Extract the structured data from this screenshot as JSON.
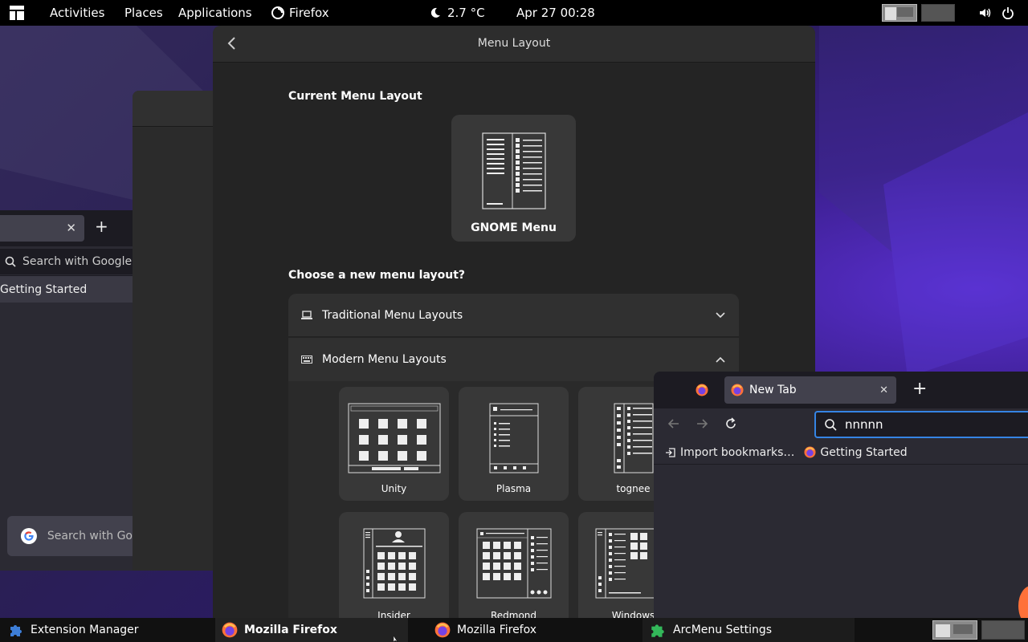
{
  "topbar": {
    "activities": "Activities",
    "places": "Places",
    "applications": "Applications",
    "active_app": "Firefox",
    "weather": "2.7 °C",
    "datetime": "Apr 27  00:28"
  },
  "left_browser": {
    "search_placeholder": "Search with Google",
    "bookmark": "Getting Started",
    "google_search": "Search with Go"
  },
  "arcmenu": {
    "title": "Menu Layout",
    "current_heading": "Current Menu Layout",
    "current_layout": "GNOME Menu",
    "choose_heading": "Choose a new menu layout?",
    "traditional": "Traditional Menu Layouts",
    "modern": "Modern Menu Layouts",
    "layouts": [
      "Unity",
      "Plasma",
      "tognee",
      "Insider",
      "Redmond",
      "Windows"
    ]
  },
  "firefox": {
    "tab_title": "New Tab",
    "url_value": "nnnnn",
    "import_bookmarks": "Import bookmarks…",
    "getting_started": "Getting Started"
  },
  "taskbar": {
    "items": [
      "Extension Manager",
      "Mozilla Firefox",
      "Mozilla Firefox",
      "ArcMenu Settings"
    ]
  },
  "colors": {
    "accent_blue": "#3584e4",
    "firefox_orange": "#ff7139",
    "extension_blue": "#3d7ed8",
    "arcmenu_green": "#33b85a"
  }
}
